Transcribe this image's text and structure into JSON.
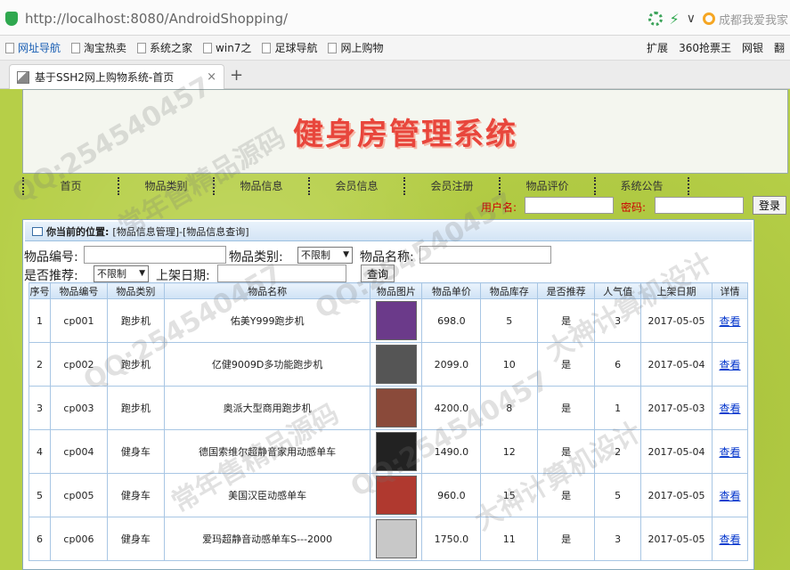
{
  "browser": {
    "url": "http://localhost:8080/AndroidShopping/",
    "search_hint": "成都我爱我家",
    "bookmarks": [
      "网址导航",
      "淘宝热卖",
      "系统之家",
      "win7之",
      "足球导航",
      "网上购物"
    ],
    "bookmarks_right": [
      "扩展",
      "360抢票王",
      "网银",
      "翻"
    ],
    "tab_title": "基于SSH2网上购物系统-首页",
    "tab_close": "×",
    "new_tab": "+"
  },
  "site": {
    "title": "健身房管理系统",
    "nav": [
      "首页",
      "物品类别",
      "物品信息",
      "会员信息",
      "会员注册",
      "物品评价",
      "系统公告"
    ],
    "login": {
      "user_label": "用户名:",
      "pwd_label": "密码:",
      "button": "登录"
    }
  },
  "breadcrumb": {
    "label": "你当前的位置:",
    "path": "[物品信息管理]-[物品信息查询]"
  },
  "search": {
    "code_label": "物品编号:",
    "category_label": "物品类别:",
    "category_value": "不限制",
    "name_label": "物品名称:",
    "recommend_label": "是否推荐:",
    "recommend_value": "不限制",
    "date_label": "上架日期:",
    "query_button": "查询"
  },
  "table": {
    "headers": [
      "序号",
      "物品编号",
      "物品类别",
      "物品名称",
      "物品图片",
      "物品单价",
      "物品库存",
      "是否推荐",
      "人气值",
      "上架日期",
      "详情"
    ],
    "rows": [
      [
        "1",
        "cp001",
        "跑步机",
        "佑美Y999跑步机",
        "",
        "698.0",
        "5",
        "是",
        "3",
        "2017-05-05",
        "查看"
      ],
      [
        "2",
        "cp002",
        "跑步机",
        "亿健9009D多功能跑步机",
        "",
        "2099.0",
        "10",
        "是",
        "6",
        "2017-05-04",
        "查看"
      ],
      [
        "3",
        "cp003",
        "跑步机",
        "奥派大型商用跑步机",
        "",
        "4200.0",
        "8",
        "是",
        "1",
        "2017-05-03",
        "查看"
      ],
      [
        "4",
        "cp004",
        "健身车",
        "德国索维尔超静音家用动感单车",
        "",
        "1490.0",
        "12",
        "是",
        "2",
        "2017-05-04",
        "查看"
      ],
      [
        "5",
        "cp005",
        "健身车",
        "美国汉臣动感单车",
        "",
        "960.0",
        "15",
        "是",
        "5",
        "2017-05-05",
        "查看"
      ],
      [
        "6",
        "cp006",
        "健身车",
        "爱玛超静音动感单车S---2000",
        "",
        "1750.0",
        "11",
        "是",
        "3",
        "2017-05-05",
        "查看"
      ]
    ],
    "thumb_colors": [
      "#6b3a8a",
      "#555555",
      "#8a4a3a",
      "#222222",
      "#b0392f",
      "#c8c8c8"
    ]
  },
  "watermarks": [
    "QQ:254540457",
    "大神计算机设计",
    "常年售精品源码"
  ]
}
